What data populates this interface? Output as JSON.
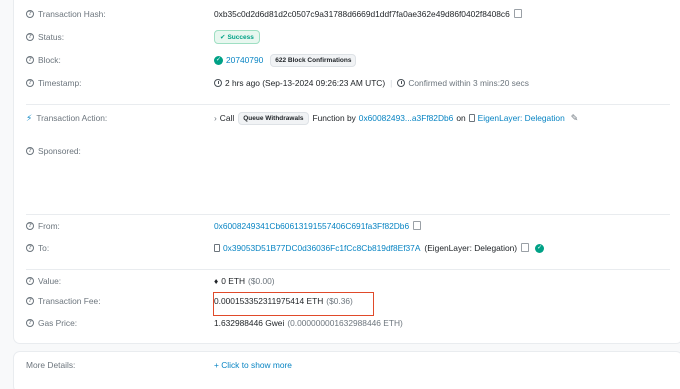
{
  "tx_hash": {
    "label": "Transaction Hash:",
    "value": "0xb35c0d2d6d81d2c0507c9a31788d6669d1ddf7fa0ae362e49d86f0402f8408c6"
  },
  "status": {
    "label": "Status:",
    "value": "Success"
  },
  "block": {
    "label": "Block:",
    "number": "20740790",
    "confirmations": "622 Block Confirmations"
  },
  "timestamp": {
    "label": "Timestamp:",
    "age": "2 hrs ago (Sep-13-2024 09:26:23 AM UTC)",
    "confirmed": "Confirmed within 3 mins:20 secs"
  },
  "action": {
    "label": "Transaction Action:",
    "call": "Call",
    "method": "Queue Withdrawals",
    "function_by": "Function by",
    "address": "0x60082493...a3Ff82Db6",
    "on": "on",
    "contract": "EigenLayer: Delegation"
  },
  "sponsored": {
    "label": "Sponsored:"
  },
  "from": {
    "label": "From:",
    "value": "0x6008249341Cb60613191557406C691fa3Ff82Db6"
  },
  "to": {
    "label": "To:",
    "address": "0x39053D51B77DC0d36036Fc1fCc8Cb819df8Ef37A",
    "name": "(EigenLayer: Delegation)"
  },
  "value": {
    "label": "Value:",
    "eth": "0 ETH",
    "usd": "($0.00)"
  },
  "fee": {
    "label": "Transaction Fee:",
    "eth": "0.000153352311975414 ETH",
    "usd": "($0.36)"
  },
  "gas": {
    "label": "Gas Price:",
    "value": "1.632988446 Gwei",
    "eth": "(0.000000001632988446 ETH)"
  },
  "more": {
    "label": "More Details:",
    "link": "+ Click to show more"
  },
  "colors": {
    "link": "#0784c3",
    "success": "#00a186",
    "highlight": "#e04a2a"
  }
}
